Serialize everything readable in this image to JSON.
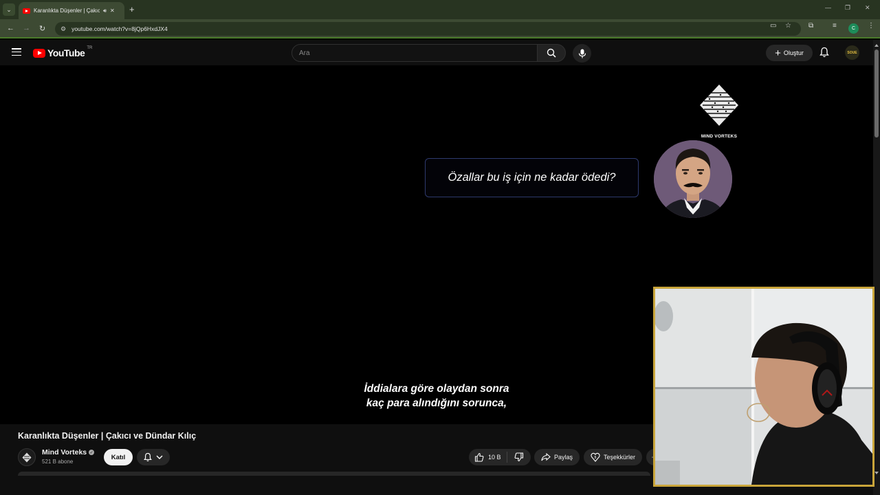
{
  "browser": {
    "tab_title": "Karanlıkta Düşenler | Çakıcı",
    "url": "youtube.com/watch?v=8jQp6HxdJX4",
    "profile_initial": "C"
  },
  "youtube": {
    "country_code": "TR",
    "search_placeholder": "Ara",
    "create_label": "Oluştur",
    "avatar_text": "SOUE",
    "brand_red": "#ff0000"
  },
  "video": {
    "logo_label": "MIND VORTEKS",
    "quote": "Özallar bu iş için ne kadar ödedi?",
    "subtitle_line1": "İddialara göre olaydan sonra",
    "subtitle_line2": "kaç para alındığını sorunca,"
  },
  "info": {
    "title": "Karanlıkta Düşenler | Çakıcı ve Dündar Kılıç",
    "channel_name": "Mind Vorteks",
    "subscribers": "521 B abone",
    "join_label": "Katıl",
    "like_count": "10 B",
    "share_label": "Paylaş",
    "thanks_label": "Teşekkürler"
  },
  "icons": {
    "tab_sound": "speaker-icon",
    "webcam_border": "#c9a53a"
  }
}
